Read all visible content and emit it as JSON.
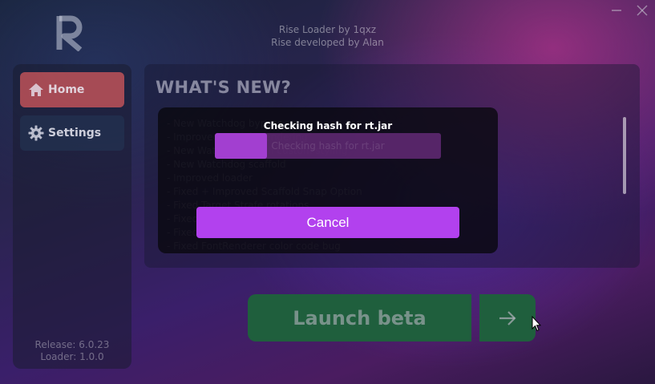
{
  "header": {
    "logo_letter": "R",
    "title": "Rise Loader by 1qxz",
    "subtitle": "Rise developed by Alan"
  },
  "window_controls": {
    "minimize_icon": "minimize-icon",
    "close_icon": "close-icon"
  },
  "sidebar": {
    "items": [
      {
        "label": "Home",
        "icon": "home-icon",
        "active": true,
        "color": "#c8555a"
      },
      {
        "label": "Settings",
        "icon": "gear-icon",
        "active": false,
        "color": "#233250"
      }
    ],
    "release_label": "Release: 6.0.23",
    "loader_label": "Loader: 1.0.0"
  },
  "main": {
    "heading": "WHAT'S NEW?",
    "changelog": [
      "- New Watchdog bypass",
      "- Improved module rendering",
      "- New Watermark with custom styling",
      "- New Watchdog scaffold",
      "- Improved loader",
      "- Fixed + Improved Scaffold Snap Option",
      "- Fixed Target Strafe rotations",
      "- Fixed Killaura autoblock",
      "- Fixed Speed flags",
      "- Fixed FontRenderer color code bug"
    ]
  },
  "launch": {
    "label": "Launch beta",
    "arrow_icon": "arrow-right-icon",
    "color": "#1f5f3d"
  },
  "modal": {
    "title": "Checking hash for rt.jar",
    "progress": 0.23,
    "progress_label": "Checking hash for rt.jar",
    "cancel_label": "Cancel",
    "accent": "#b241ee"
  }
}
